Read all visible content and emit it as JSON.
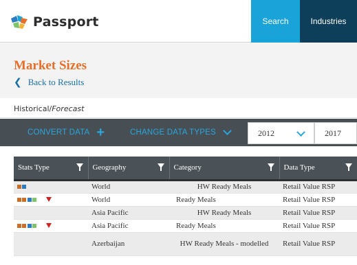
{
  "header": {
    "logo_text": "Passport",
    "nav": [
      {
        "label": "Search",
        "active": true
      },
      {
        "label": "Industries"
      }
    ]
  },
  "page": {
    "title": "Market Sizes",
    "back_link": "Back to Results",
    "historical_label": "Historical/",
    "forecast_label": "Forecast"
  },
  "toolbar": {
    "convert_label": "CONVERT DATA",
    "change_label": "CHANGE DATA TYPES",
    "year_from": "2012",
    "year_to": "2017"
  },
  "table": {
    "headers": [
      "Stats Type",
      "Geography",
      "Category",
      "Data Type"
    ],
    "rows": [
      {
        "stats": [
          "#c86f2c",
          "#2e7bbf"
        ],
        "indicator": false,
        "geography": "World",
        "category": "HW Ready Meals",
        "category_indent": true,
        "data_type": "Retail Value RSP"
      },
      {
        "stats": [
          "#c86f2c",
          "#c86f2c",
          "#2e7bbf",
          "#7fc46a"
        ],
        "indicator": true,
        "geography": "World",
        "category": "Ready Meals",
        "category_indent": false,
        "data_type": "Retail Value RSP"
      },
      {
        "stats": [],
        "indicator": false,
        "geography": "Asia Pacific",
        "category": "HW Ready Meals",
        "category_indent": true,
        "data_type": "Retail Value RSP"
      },
      {
        "stats": [
          "#c86f2c",
          "#c86f2c",
          "#2e7bbf",
          "#7fc46a"
        ],
        "indicator": true,
        "geography": "Asia Pacific",
        "category": "Ready Meals",
        "category_indent": false,
        "data_type": "Retail Value RSP"
      },
      {
        "stats": [],
        "indicator": false,
        "geography": "Azerbaijan",
        "category": "HW Ready Meals - modelled",
        "category_indent": true,
        "data_type": "Retail Value RSP"
      }
    ]
  },
  "colors": {
    "accent_orange": "#e76f2a",
    "nav_blue": "#1aa3d9",
    "nav_dark": "#0d3e5a",
    "toolbar_bg": "#474f54",
    "indicator_red": "#d62020"
  }
}
